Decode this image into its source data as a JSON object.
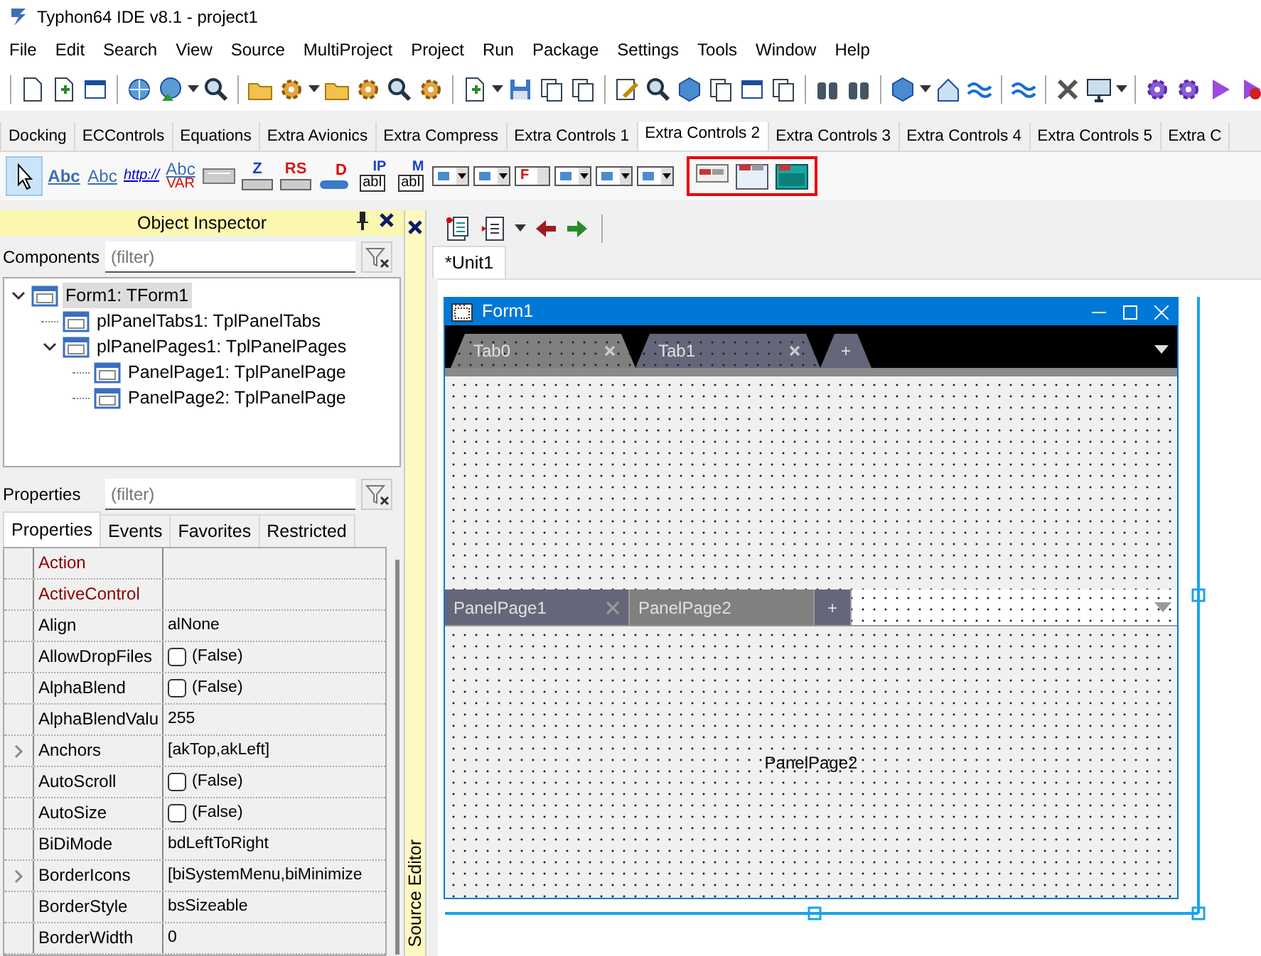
{
  "window": {
    "title": "Typhon64 IDE v8.1 - project1"
  },
  "menu": [
    "File",
    "Edit",
    "Search",
    "View",
    "Source",
    "MultiProject",
    "Project",
    "Run",
    "Package",
    "Settings",
    "Tools",
    "Window",
    "Help"
  ],
  "palette": {
    "tabs": [
      {
        "label": "Docking",
        "selected": false
      },
      {
        "label": "ECControls",
        "selected": false
      },
      {
        "label": "Equations",
        "selected": false
      },
      {
        "label": "Extra Avionics",
        "selected": false
      },
      {
        "label": "Extra Compress",
        "selected": false
      },
      {
        "label": "Extra Controls 1",
        "selected": false
      },
      {
        "label": "Extra Controls 2",
        "selected": true
      },
      {
        "label": "Extra Controls 3",
        "selected": false
      },
      {
        "label": "Extra Controls 4",
        "selected": false
      },
      {
        "label": "Extra Controls 5",
        "selected": false
      },
      {
        "label": "Extra C",
        "selected": false
      }
    ],
    "items": [
      {
        "kind": "pointer",
        "selected": true
      },
      {
        "kind": "label",
        "top": "Abc"
      },
      {
        "kind": "starlabel",
        "top": "Abc"
      },
      {
        "kind": "link",
        "top": "http://"
      },
      {
        "kind": "label",
        "top": "Abc",
        "bottom": "VAR"
      },
      {
        "kind": "bar"
      },
      {
        "kind": "zorder",
        "top": "Z"
      },
      {
        "kind": "rslatch",
        "top": "RS"
      },
      {
        "kind": "slider",
        "top": "D"
      },
      {
        "kind": "edit",
        "top": "IP",
        "bottom": "abI"
      },
      {
        "kind": "edit",
        "top": "M",
        "bottom": "abI"
      },
      {
        "kind": "combo"
      },
      {
        "kind": "combo"
      },
      {
        "kind": "fontcombo",
        "top": "F"
      },
      {
        "kind": "combo"
      },
      {
        "kind": "combo"
      },
      {
        "kind": "combo"
      }
    ],
    "highlighted_items": [
      {
        "kind": "tabs"
      },
      {
        "kind": "pages"
      },
      {
        "kind": "teal"
      }
    ]
  },
  "object_inspector": {
    "title": "Object Inspector",
    "components_label": "Components",
    "components_filter": {
      "placeholder": "(filter)"
    },
    "tree": [
      {
        "label": "Form1: TForm1",
        "selected": true,
        "expanded": true,
        "children": [
          {
            "label": "plPanelTabs1: TplPanelTabs",
            "selected": false
          },
          {
            "label": "plPanelPages1: TplPanelPages",
            "selected": false,
            "expanded": true,
            "children": [
              {
                "label": "PanelPage1: TplPanelPage",
                "selected": false
              },
              {
                "label": "PanelPage2: TplPanelPage",
                "selected": false
              }
            ]
          }
        ]
      }
    ],
    "properties_label": "Properties",
    "properties_filter": {
      "placeholder": "(filter)"
    },
    "tabs": [
      {
        "label": "Properties",
        "selected": true
      },
      {
        "label": "Events",
        "selected": false
      },
      {
        "label": "Favorites",
        "selected": false
      },
      {
        "label": "Restricted",
        "selected": false
      }
    ],
    "properties": [
      {
        "name": "Action",
        "kind": "text",
        "linked": true
      },
      {
        "name": "ActiveControl",
        "kind": "text",
        "linked": true
      },
      {
        "name": "Align",
        "kind": "text",
        "value": "alNone",
        "linked": false
      },
      {
        "name": "AllowDropFiles",
        "kind": "check",
        "value": "(False)",
        "checked": false,
        "linked": false
      },
      {
        "name": "AlphaBlend",
        "kind": "check",
        "value": "(False)",
        "checked": false,
        "linked": false
      },
      {
        "name": "AlphaBlendValu",
        "kind": "text",
        "value": "255",
        "linked": false
      },
      {
        "name": "Anchors",
        "kind": "set",
        "value": "[akTop,akLeft]",
        "linked": false
      },
      {
        "name": "AutoScroll",
        "kind": "check",
        "value": "(False)",
        "checked": false,
        "linked": false
      },
      {
        "name": "AutoSize",
        "kind": "check",
        "value": "(False)",
        "checked": false,
        "linked": false
      },
      {
        "name": "BiDiMode",
        "kind": "text",
        "value": "bdLeftToRight",
        "linked": false
      },
      {
        "name": "BorderIcons",
        "kind": "set",
        "value": "[biSystemMenu,biMinimize",
        "linked": false
      },
      {
        "name": "BorderStyle",
        "kind": "text",
        "value": "bsSizeable",
        "linked": false
      },
      {
        "name": "BorderWidth",
        "kind": "text",
        "value": "0",
        "linked": false
      }
    ]
  },
  "side_strip": {
    "label": "Source Editor"
  },
  "editor": {
    "tabs": [
      {
        "label": "*Unit1",
        "selected": true
      }
    ],
    "form": {
      "title": "Form1",
      "tabs": [
        {
          "label": "Tab0",
          "selected": true
        },
        {
          "label": "Tab1",
          "selected": false
        }
      ],
      "tabs_add": "+",
      "pages": [
        {
          "label": "PanelPage1",
          "selected": false
        },
        {
          "label": "PanelPage2",
          "selected": true
        }
      ],
      "pages_add": "+",
      "page_caption": "PanelPage2"
    }
  }
}
